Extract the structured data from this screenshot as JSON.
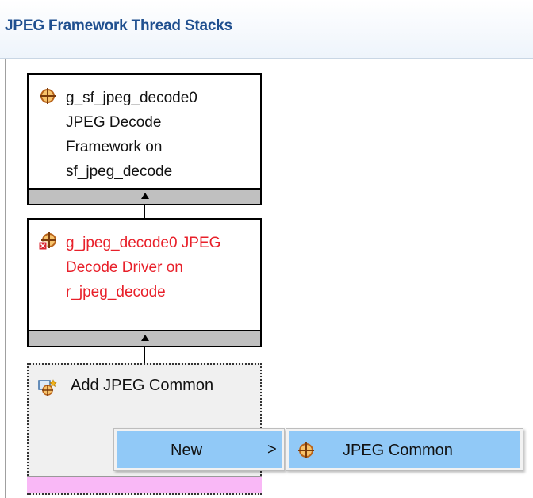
{
  "header": {
    "title": "JPEG Framework Thread Stacks"
  },
  "blocks": [
    {
      "lines": [
        "g_sf_jpeg_decode0",
        "JPEG Decode",
        "Framework on",
        "sf_jpeg_decode"
      ],
      "icon": "module-crosshair-icon",
      "error": false
    },
    {
      "lines": [
        "g_jpeg_decode0 JPEG",
        "Decode Driver on",
        "r_jpeg_decode"
      ],
      "icon": "module-crosshair-error-icon",
      "error": true
    }
  ],
  "add_block": {
    "label": "Add JPEG Common",
    "icon": "add-module-icon"
  },
  "context_menu": {
    "item_label": "New",
    "chevron": ">"
  },
  "submenu": {
    "item_label": "JPEG Common",
    "icon": "module-crosshair-icon"
  },
  "colors": {
    "header_text": "#1f4f8f",
    "error_text": "#e8202a",
    "menu_highlight": "#91c9f7",
    "add_bar": "#f9b8f6",
    "bar_gray": "#c0c0c0"
  }
}
